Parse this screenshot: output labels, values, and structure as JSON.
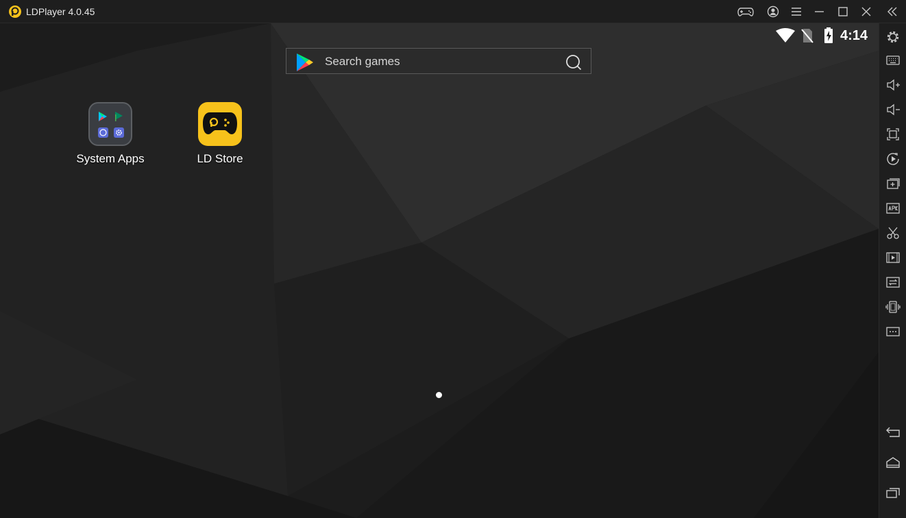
{
  "window": {
    "title": "LDPlayer 4.0.45"
  },
  "titlebar": {
    "buttons": [
      {
        "icon": "gamepad-icon"
      },
      {
        "icon": "account-icon"
      },
      {
        "icon": "menu-icon"
      },
      {
        "icon": "minimize-icon"
      },
      {
        "icon": "maximize-icon"
      },
      {
        "icon": "close-icon"
      },
      {
        "icon": "collapse-sidebar-icon"
      }
    ]
  },
  "statusbar": {
    "time": "4:14",
    "icons": [
      "wifi-icon",
      "no-sim-icon",
      "battery-charging-icon"
    ]
  },
  "search": {
    "placeholder": "Search games"
  },
  "home": {
    "apps": [
      {
        "label": "System Apps",
        "icon": "system-apps-folder-icon"
      },
      {
        "label": "LD Store",
        "icon": "ld-store-icon"
      }
    ],
    "page_count": 1,
    "current_page": 1
  },
  "sidebar": {
    "items": [
      "settings-icon",
      "keyboard-mapping-icon",
      "volume-up-icon",
      "volume-down-icon",
      "fullscreen-icon",
      "operation-record-icon",
      "add-multi-instance-icon",
      "install-apk-icon",
      "screenshot-icon",
      "record-video-icon",
      "sync-icon",
      "shake-icon",
      "more-icon",
      "back-icon",
      "home-icon",
      "recent-apps-icon"
    ]
  },
  "colors": {
    "titlebar_bg": "#1e1e1e",
    "screen_bg": "#1d1d1d",
    "accent_yellow": "#f7c21b",
    "icon_gray": "#c8c8c8"
  }
}
